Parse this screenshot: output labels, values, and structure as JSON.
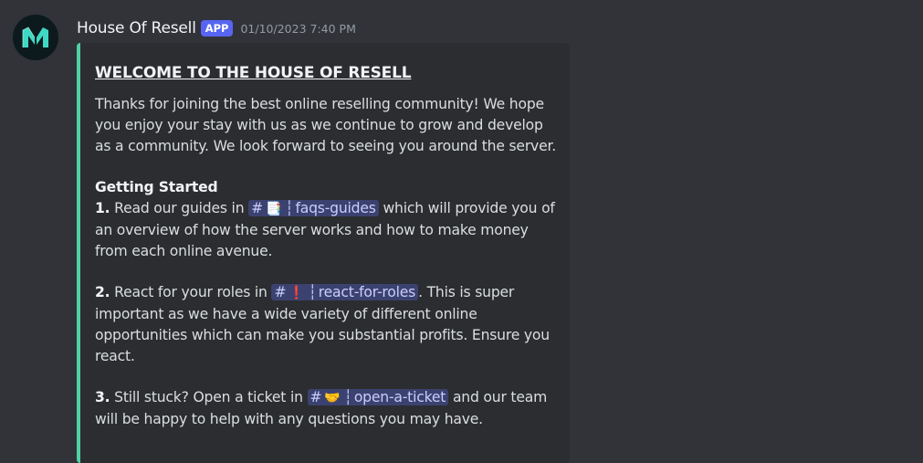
{
  "message": {
    "author": "House Of Resell",
    "badge": "APP",
    "timestamp": "01/10/2023 7:40 PM",
    "avatar_icon": "house-of-resell-logo"
  },
  "embed": {
    "accent_color": "#4fd1a3",
    "title": "WELCOME TO THE HOUSE OF RESELL",
    "intro": "Thanks for joining the best online reselling community! We hope you enjoy your stay with us as we continue to grow and develop as a community. We look forward to seeing you around the server.",
    "section_heading": "Getting Started",
    "steps": [
      {
        "number": "1.",
        "before": "Read our guides in",
        "channel_hash": "#",
        "channel_emoji": "📑",
        "channel_sep": "┆",
        "channel_name": "faqs-guides",
        "after": "which will provide you of an overview of how the server works and how to make money from each online avenue."
      },
      {
        "number": "2.",
        "before": "React for your roles in",
        "channel_hash": "#",
        "channel_emoji": "❗",
        "channel_sep": "┆",
        "channel_name": "react-for-roles",
        "after": ". This is super important as we have a wide variety of different online opportunities which can make you substantial profits. Ensure you react."
      },
      {
        "number": "3.",
        "before": "Still stuck? Open a ticket in",
        "channel_hash": "#",
        "channel_emoji": "🤝",
        "channel_sep": "┆",
        "channel_name": "open-a-ticket",
        "after": "and our team will be happy to help with any questions you may have."
      }
    ]
  }
}
